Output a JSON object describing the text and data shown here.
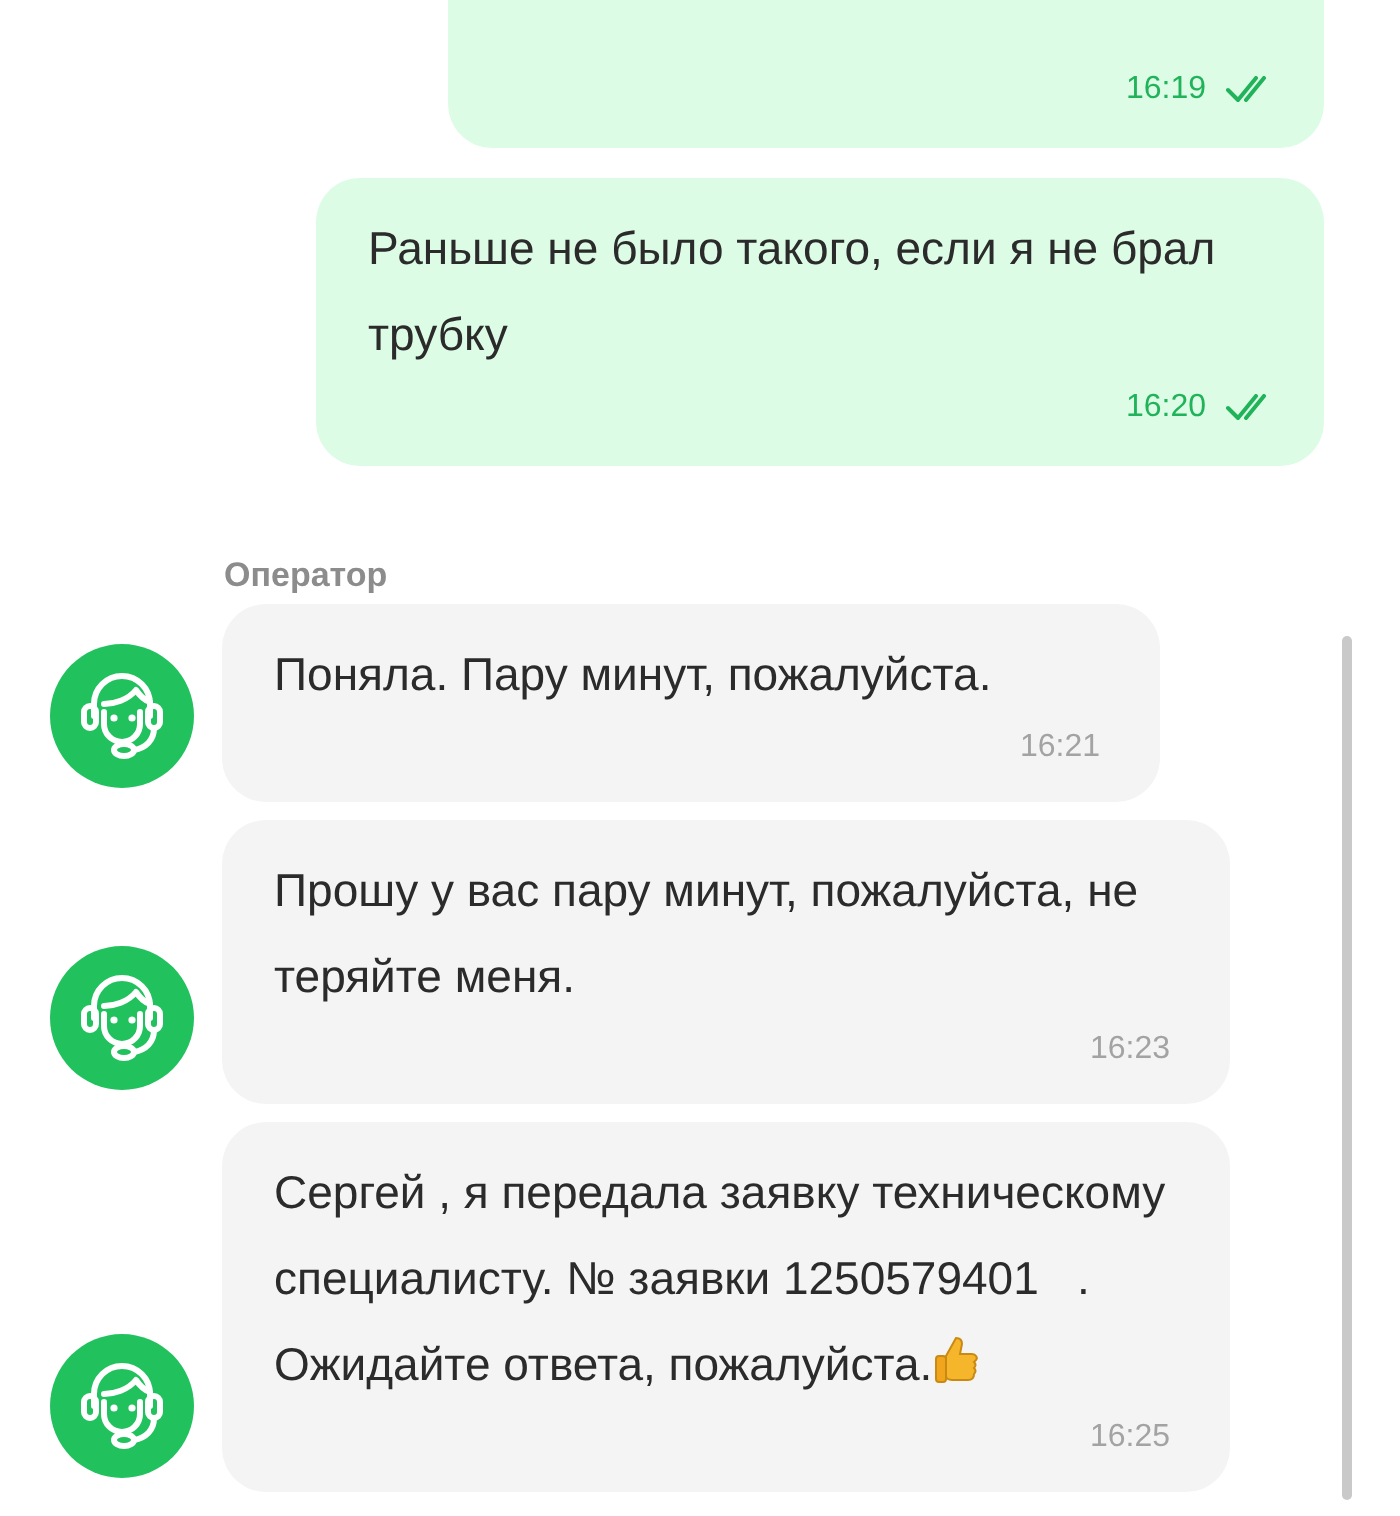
{
  "outgoing": [
    {
      "time": "16:19",
      "read": true
    },
    {
      "text": "Раньше не было такого, если я не брал трубку",
      "time": "16:20",
      "read": true
    }
  ],
  "operator": {
    "name": "Оператор",
    "messages": [
      {
        "text": "Поняла. Пару минут, пожалуйста.",
        "time": "16:21"
      },
      {
        "text": "Прошу у вас пару минут, пожалуйста, не теряйте меня.",
        "time": "16:23"
      },
      {
        "text": "Сергей , я передала заявку техническому специалисту. № заявки 1250579401   . Ожидайте ответа, пожалуйста.",
        "time": "16:25",
        "trailing_icon": true
      }
    ]
  }
}
